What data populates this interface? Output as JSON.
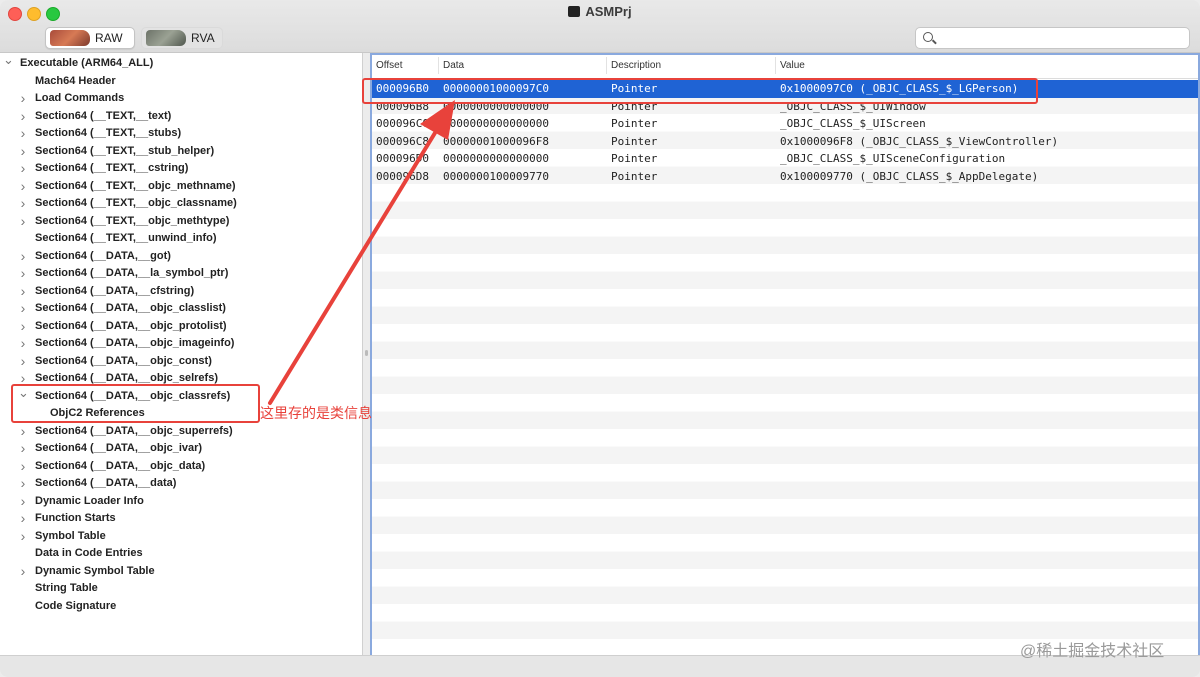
{
  "window": {
    "title": "ASMPrj"
  },
  "toolbar": {
    "raw_label": "RAW",
    "rva_label": "RVA",
    "search_placeholder": ""
  },
  "sidebar": {
    "items": [
      {
        "label": "Executable  (ARM64_ALL)",
        "indent": 0,
        "chevron": "down"
      },
      {
        "label": "Mach64 Header",
        "indent": 1,
        "chevron": "none"
      },
      {
        "label": "Load Commands",
        "indent": 1,
        "chevron": "right"
      },
      {
        "label": "Section64 (__TEXT,__text)",
        "indent": 1,
        "chevron": "right"
      },
      {
        "label": "Section64 (__TEXT,__stubs)",
        "indent": 1,
        "chevron": "right"
      },
      {
        "label": "Section64 (__TEXT,__stub_helper)",
        "indent": 1,
        "chevron": "right"
      },
      {
        "label": "Section64 (__TEXT,__cstring)",
        "indent": 1,
        "chevron": "right"
      },
      {
        "label": "Section64 (__TEXT,__objc_methname)",
        "indent": 1,
        "chevron": "right"
      },
      {
        "label": "Section64 (__TEXT,__objc_classname)",
        "indent": 1,
        "chevron": "right"
      },
      {
        "label": "Section64 (__TEXT,__objc_methtype)",
        "indent": 1,
        "chevron": "right"
      },
      {
        "label": "Section64 (__TEXT,__unwind_info)",
        "indent": 1,
        "chevron": "none"
      },
      {
        "label": "Section64 (__DATA,__got)",
        "indent": 1,
        "chevron": "right"
      },
      {
        "label": "Section64 (__DATA,__la_symbol_ptr)",
        "indent": 1,
        "chevron": "right"
      },
      {
        "label": "Section64 (__DATA,__cfstring)",
        "indent": 1,
        "chevron": "right"
      },
      {
        "label": "Section64 (__DATA,__objc_classlist)",
        "indent": 1,
        "chevron": "right"
      },
      {
        "label": "Section64 (__DATA,__objc_protolist)",
        "indent": 1,
        "chevron": "right"
      },
      {
        "label": "Section64 (__DATA,__objc_imageinfo)",
        "indent": 1,
        "chevron": "right"
      },
      {
        "label": "Section64 (__DATA,__objc_const)",
        "indent": 1,
        "chevron": "right"
      },
      {
        "label": "Section64 (__DATA,__objc_selrefs)",
        "indent": 1,
        "chevron": "right"
      },
      {
        "label": "Section64 (__DATA,__objc_classrefs)",
        "indent": 1,
        "chevron": "down"
      },
      {
        "label": "ObjC2 References",
        "indent": 2,
        "chevron": "none"
      },
      {
        "label": "Section64 (__DATA,__objc_superrefs)",
        "indent": 1,
        "chevron": "right"
      },
      {
        "label": "Section64 (__DATA,__objc_ivar)",
        "indent": 1,
        "chevron": "right"
      },
      {
        "label": "Section64 (__DATA,__objc_data)",
        "indent": 1,
        "chevron": "right"
      },
      {
        "label": "Section64 (__DATA,__data)",
        "indent": 1,
        "chevron": "right"
      },
      {
        "label": "Dynamic Loader Info",
        "indent": 1,
        "chevron": "right"
      },
      {
        "label": "Function Starts",
        "indent": 1,
        "chevron": "right"
      },
      {
        "label": "Symbol Table",
        "indent": 1,
        "chevron": "right"
      },
      {
        "label": "Data in Code Entries",
        "indent": 1,
        "chevron": "none"
      },
      {
        "label": "Dynamic Symbol Table",
        "indent": 1,
        "chevron": "right"
      },
      {
        "label": "String Table",
        "indent": 1,
        "chevron": "none"
      },
      {
        "label": "Code Signature",
        "indent": 1,
        "chevron": "none"
      }
    ]
  },
  "table": {
    "headers": {
      "offset": "Offset",
      "data": "Data",
      "description": "Description",
      "value": "Value"
    },
    "selected_index": 0,
    "rows": [
      {
        "offset": "000096B0",
        "data": "00000001000097C0",
        "description": "Pointer",
        "value": "0x1000097C0 (_OBJC_CLASS_$_LGPerson)"
      },
      {
        "offset": "000096B8",
        "data": "0000000000000000",
        "description": "Pointer",
        "value": "_OBJC_CLASS_$_UIWindow"
      },
      {
        "offset": "000096C0",
        "data": "0000000000000000",
        "description": "Pointer",
        "value": "_OBJC_CLASS_$_UIScreen"
      },
      {
        "offset": "000096C8",
        "data": "00000001000096F8",
        "description": "Pointer",
        "value": "0x1000096F8 (_OBJC_CLASS_$_ViewController)"
      },
      {
        "offset": "000096D0",
        "data": "0000000000000000",
        "description": "Pointer",
        "value": "_OBJC_CLASS_$_UISceneConfiguration"
      },
      {
        "offset": "000096D8",
        "data": "0000000100009770",
        "description": "Pointer",
        "value": "0x100009770 (_OBJC_CLASS_$_AppDelegate)"
      }
    ]
  },
  "annotation": {
    "text": "这里存的是类信息",
    "color": "#e8423b"
  },
  "watermark": {
    "text": "@稀土掘金技术社区"
  },
  "colors": {
    "selection": "#1f63d4",
    "highlight": "#e8423b",
    "table_border": "#8aa9de"
  }
}
